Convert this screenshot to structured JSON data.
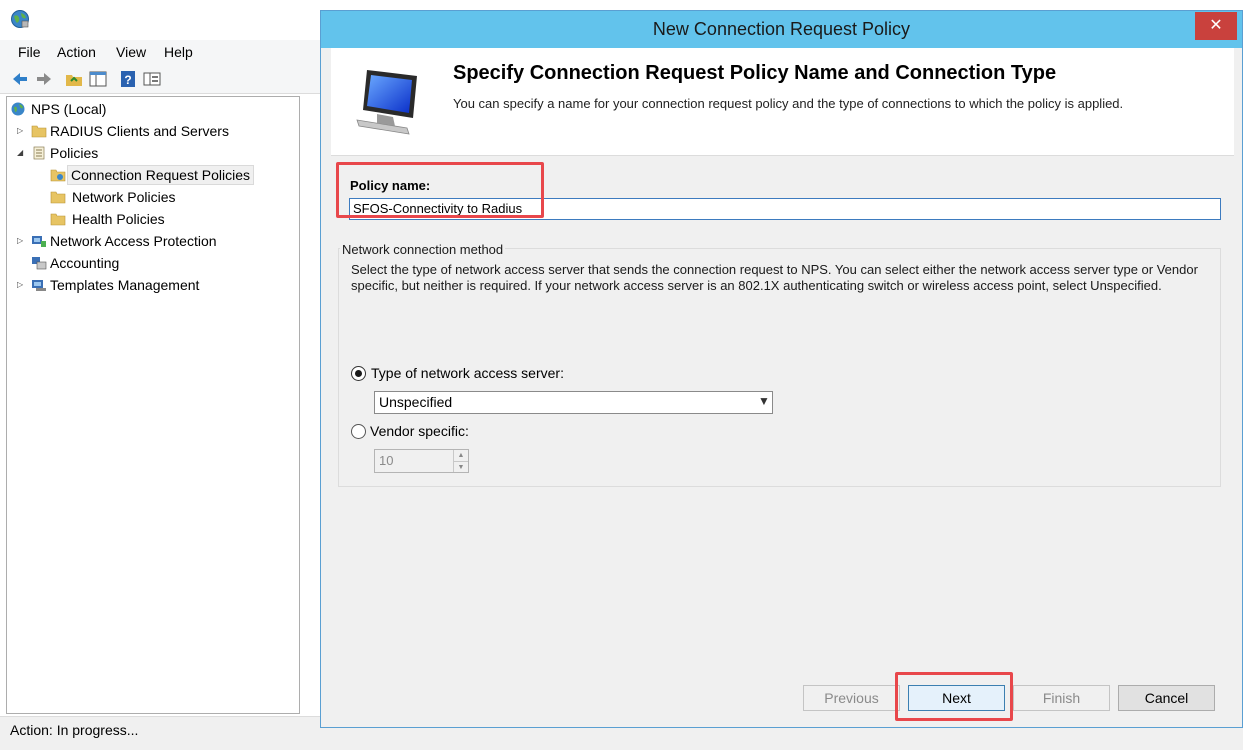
{
  "mmc": {
    "menu": [
      "File",
      "Action",
      "View",
      "Help"
    ],
    "tree": {
      "root": "NPS (Local)",
      "radius_clients": "RADIUS Clients and Servers",
      "policies": "Policies",
      "crp": "Connection Request Policies",
      "network_policies": "Network Policies",
      "health_policies": "Health Policies",
      "nap": "Network Access Protection",
      "accounting": "Accounting",
      "templates": "Templates Management"
    },
    "status": "Action:  In progress..."
  },
  "dialog": {
    "title": "New Connection Request Policy",
    "close_glyph": "✕",
    "header": {
      "title": "Specify Connection Request Policy Name and Connection Type",
      "subtitle": "You can specify a name for your connection request policy and the type of connections to which the policy is applied."
    },
    "policy_name_label": "Policy name:",
    "policy_name_value": "SFOS-Connectivity to Radius",
    "ncm": {
      "title": "Network connection method",
      "description": "Select the type of network access server that sends the connection request to NPS. You can select either the network access server type or Vendor specific, but neither is required.  If your network access server is an 802.1X authenticating switch or wireless access point, select Unspecified.",
      "radio_nas_label": "Type of network access server:",
      "nas_selected": "Unspecified",
      "radio_vendor_label": "Vendor specific:",
      "vendor_value": "10"
    },
    "buttons": {
      "previous": "Previous",
      "next": "Next",
      "finish": "Finish",
      "cancel": "Cancel"
    }
  },
  "colors": {
    "title_bar": "#62c3ec",
    "close_button": "#c9413d",
    "highlight": "#e8474b"
  }
}
